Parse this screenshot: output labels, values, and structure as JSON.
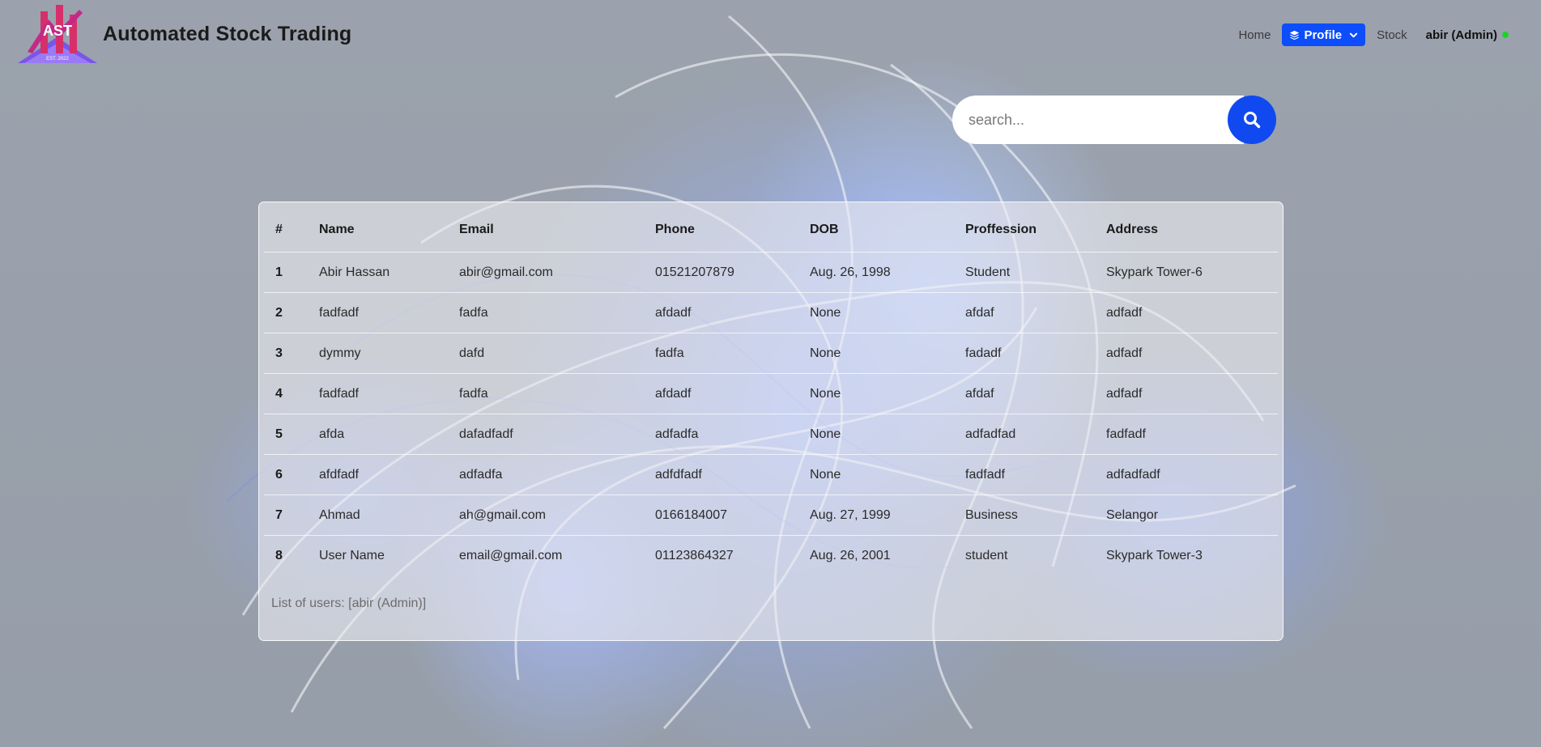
{
  "app": {
    "brand": "Automated Stock Trading",
    "logo_text": "AST",
    "logo_subtext": "EST. 2022"
  },
  "nav": {
    "home": "Home",
    "profile": "Profile",
    "stock": "Stock",
    "user": "abir (Admin)",
    "status_color": "#1fd12a",
    "accent": "#0d4dfb"
  },
  "search": {
    "placeholder": "search...",
    "icon": "search-icon"
  },
  "table": {
    "headers": [
      "#",
      "Name",
      "Email",
      "Phone",
      "DOB",
      "Proffession",
      "Address"
    ],
    "rows": [
      [
        "1",
        "Abir Hassan",
        "abir@gmail.com",
        "01521207879",
        "Aug. 26, 1998",
        "Student",
        "Skypark Tower-6"
      ],
      [
        "2",
        "fadfadf",
        "fadfa",
        "afdadf",
        "None",
        "afdaf",
        "adfadf"
      ],
      [
        "3",
        "dymmy",
        "dafd",
        "fadfa",
        "None",
        "fadadf",
        "adfadf"
      ],
      [
        "4",
        "fadfadf",
        "fadfa",
        "afdadf",
        "None",
        "afdaf",
        "adfadf"
      ],
      [
        "5",
        "afda",
        "dafadfadf",
        "adfadfa",
        "None",
        "adfadfad",
        "fadfadf"
      ],
      [
        "6",
        "afdfadf",
        "adfadfa",
        "adfdfadf",
        "None",
        "fadfadf",
        "adfadfadf"
      ],
      [
        "7",
        "Ahmad",
        "ah@gmail.com",
        "0166184007",
        "Aug. 27, 1999",
        "Business",
        "Selangor"
      ],
      [
        "8",
        "User Name",
        "email@gmail.com",
        "01123864327",
        "Aug. 26, 2001",
        "student",
        "Skypark Tower-3"
      ]
    ],
    "caption": "List of users: [abir (Admin)]"
  }
}
